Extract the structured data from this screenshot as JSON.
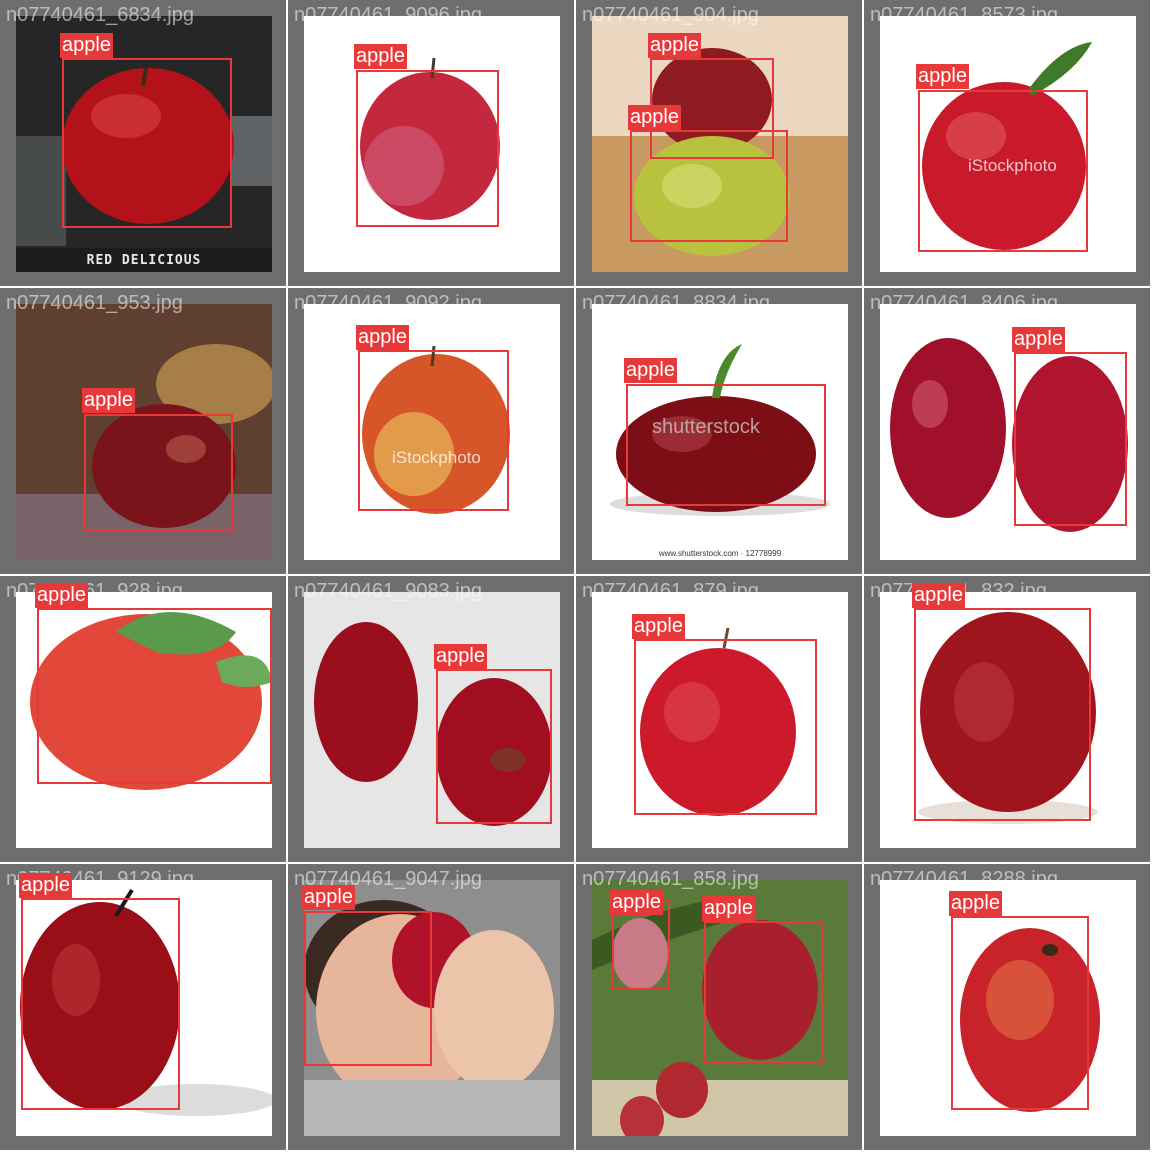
{
  "accent_color": "#e8393a",
  "tile_border_color": "#6e6e6e",
  "detection_label": "apple",
  "images": [
    {
      "filename": "n07740461_6834.jpg",
      "scene": "dark",
      "caption": "RED DELICIOUS",
      "detections": [
        "apple"
      ]
    },
    {
      "filename": "n07740461_9096.jpg",
      "scene": "white",
      "detections": [
        "apple"
      ]
    },
    {
      "filename": "n07740461_904.jpg",
      "scene": "wood",
      "detections": [
        "apple",
        "apple"
      ]
    },
    {
      "filename": "n07740461_8573.jpg",
      "scene": "white",
      "watermark": "iStockphoto",
      "detections": [
        "apple"
      ]
    },
    {
      "filename": "n07740461_953.jpg",
      "scene": "still-life",
      "detections": [
        "apple"
      ]
    },
    {
      "filename": "n07740461_9092.jpg",
      "scene": "white",
      "watermark": "iStockphoto",
      "detections": [
        "apple"
      ]
    },
    {
      "filename": "n07740461_8834.jpg",
      "scene": "white",
      "watermark": "shutterstock",
      "credit": "www.shutterstock.com · 12778999",
      "detections": [
        "apple"
      ]
    },
    {
      "filename": "n07740461_8406.jpg",
      "scene": "white",
      "detections": [
        "apple"
      ]
    },
    {
      "filename": "n07740461_928.jpg",
      "scene": "white",
      "detections": [
        "apple"
      ]
    },
    {
      "filename": "n07740461_9083.jpg",
      "scene": "grey",
      "detections": [
        "apple"
      ]
    },
    {
      "filename": "n07740461_879.jpg",
      "scene": "white",
      "detections": [
        "apple"
      ]
    },
    {
      "filename": "n07740461_832.jpg",
      "scene": "white",
      "detections": [
        "apple"
      ]
    },
    {
      "filename": "n07740461_9129.jpg",
      "scene": "white",
      "detections": [
        "apple"
      ]
    },
    {
      "filename": "n07740461_9047.jpg",
      "scene": "person",
      "detections": [
        "apple"
      ]
    },
    {
      "filename": "n07740461_858.jpg",
      "scene": "tree",
      "detections": [
        "apple",
        "apple"
      ]
    },
    {
      "filename": "n07740461_8288.jpg",
      "scene": "white",
      "detections": [
        "apple"
      ]
    }
  ]
}
